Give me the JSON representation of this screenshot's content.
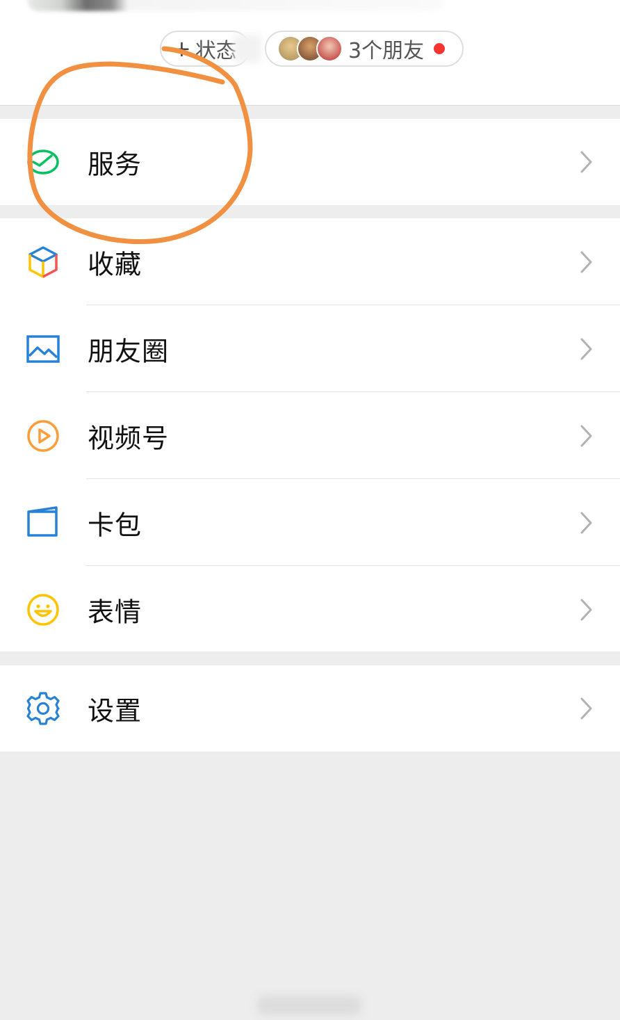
{
  "header": {
    "status_pill": {
      "plus": "+",
      "label": "状态"
    },
    "friends_pill": {
      "label": "3个朋友",
      "badge_color": "#f43530"
    }
  },
  "menu": {
    "service": {
      "label": "服务",
      "icon": "wechat-pay-check-icon",
      "icon_color": "#07c160"
    },
    "items": [
      {
        "label": "收藏",
        "icon": "favorites-cube-icon"
      },
      {
        "label": "朋友圈",
        "icon": "moments-image-icon",
        "icon_color": "#2782d7"
      },
      {
        "label": "视频号",
        "icon": "channels-play-icon",
        "icon_color": "#fa9d3b"
      },
      {
        "label": "卡包",
        "icon": "card-wallet-icon",
        "icon_color": "#2782d7"
      },
      {
        "label": "表情",
        "icon": "sticker-smile-icon",
        "icon_color": "#ffc300"
      }
    ],
    "settings": {
      "label": "设置",
      "icon": "gear-icon",
      "icon_color": "#2782d7"
    }
  },
  "annotation": {
    "stroke_color": "#f09040",
    "shape": "hand-drawn circle around 服务"
  }
}
